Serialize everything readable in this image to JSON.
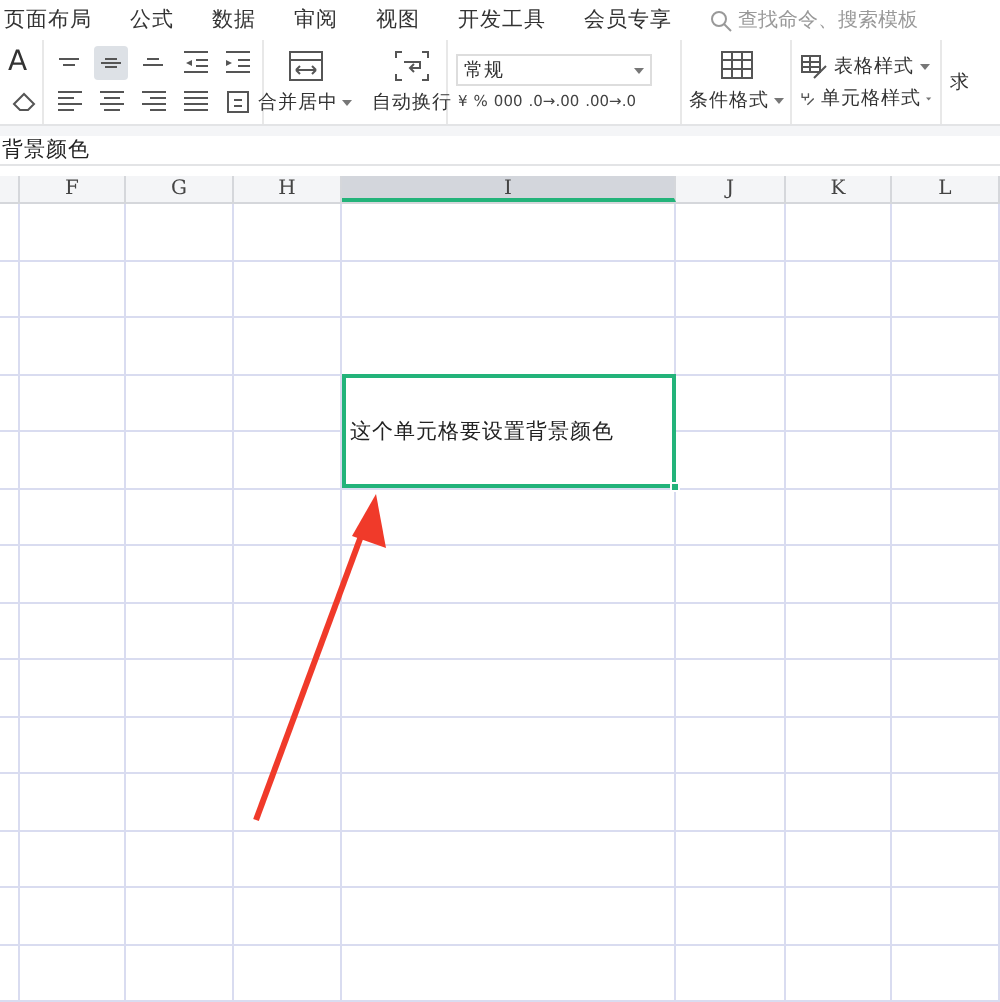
{
  "menu": [
    "页面布局",
    "公式",
    "数据",
    "审阅",
    "视图",
    "开发工具",
    "会员专享"
  ],
  "search": {
    "placeholder": "查找命令、搜索模板"
  },
  "font_tools": [
    {
      "kind": "grow",
      "label": "A"
    },
    {
      "kind": "eraser"
    }
  ],
  "align_buttons": [
    {
      "kind": "top",
      "selected": false
    },
    {
      "kind": "middle",
      "selected": true
    },
    {
      "kind": "bottom",
      "selected": false
    },
    {
      "kind": "outdent",
      "selected": false
    },
    {
      "kind": "indent",
      "selected": false
    },
    {
      "kind": "left",
      "selected": false
    },
    {
      "kind": "center",
      "selected": false
    },
    {
      "kind": "right",
      "selected": false
    },
    {
      "kind": "justify",
      "selected": false
    },
    {
      "kind": "distributed",
      "selected": false
    }
  ],
  "merge": {
    "label": "合并居中"
  },
  "wrap": {
    "label": "自动换行"
  },
  "number_format": {
    "value": "常规"
  },
  "number_buttons": [
    "¥",
    "%",
    "000",
    ".0→.00",
    ".00→.0"
  ],
  "conditional": {
    "label": "条件格式"
  },
  "styles": [
    {
      "kind": "table",
      "label": "表格样式"
    },
    {
      "kind": "cell",
      "label": "单元格样式"
    }
  ],
  "cut_label": "求",
  "formula_bar": {
    "value": "背景颜色"
  },
  "columns": [
    {
      "selected": false
    },
    {
      "label": "F",
      "selected": false
    },
    {
      "label": "G",
      "selected": false
    },
    {
      "label": "H",
      "selected": false
    },
    {
      "label": "I",
      "selected": true
    },
    {
      "label": "J",
      "selected": false
    },
    {
      "label": "K",
      "selected": false
    },
    {
      "label": "L",
      "selected": false
    }
  ],
  "active_cell": {
    "text": "这个单元格要设置背景颜色"
  }
}
